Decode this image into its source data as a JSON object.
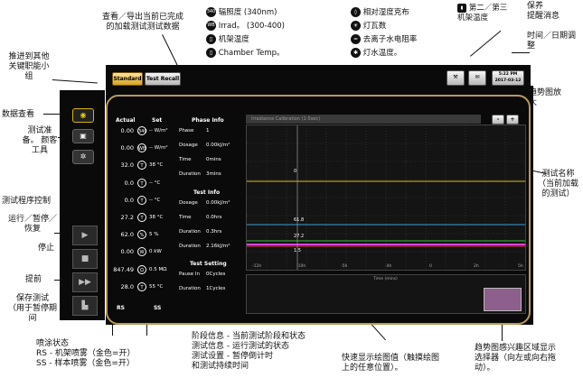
{
  "annotations": {
    "recall": "查看／导出当前已完成\n的加载测试测试数据",
    "push_keys": "推进到其他\n关键职能小\n组",
    "data_view": "数据查看",
    "test_prep": "测试准\n备。 颜客\n工具",
    "test_control": "测试程序控制",
    "run_pause": "运行／暂停／\n恢复",
    "stop": "停止",
    "advance": "提前",
    "save_test": "保存测试\n（用于暂停期\n间",
    "spray_status": "喷涂状态\nRS - 机架喷雾（金色=开）\nSS - 样本喷雾（金色=开）",
    "phase_info": "阶段信息 - 当前测试阶段和状态\n测试信息 - 运行测试的状态\n测试设置 - 暂停倒计时\n和测试持续时间",
    "cursor": "快速显示绘图值（触摸绘图\n上的任意位置）。",
    "trend_selector": "趋势图感兴趣区域显示\n选择器（向左或向右拖\n动）。",
    "test_name": "测试名称\n（当前加载\n的测试）",
    "zoom": "趋势图放\n大",
    "maintenance": "保养\n提醒消息",
    "datetime": "时间／日期调\n整"
  },
  "legend": {
    "irradiance_340": "辐照度 (340nm)",
    "irrad_range": "Irrad。 (300-400)",
    "rack_temp": "机架温度",
    "chamber_temp": "Chamber Temp。",
    "rh": "相对湿度克布",
    "lamp_watts": "灯瓦数",
    "di_water": "去离子水电阻率",
    "lamp_temp": "灯水温度。",
    "rack23_temp": "第二／第三\n机架温度"
  },
  "top_buttons": {
    "standard": "Standard",
    "test_recall": "Test Recall",
    "time": "5:22 PM",
    "date": "2017-03-12"
  },
  "readings": {
    "col_actual": "Actual",
    "col_set": "Set",
    "rows": [
      {
        "actual": "0.00",
        "icon": "340",
        "set": "-- W/m²"
      },
      {
        "actual": "0.00",
        "icon": "WB",
        "set": "-- W/m²"
      },
      {
        "actual": "32.0",
        "icon": "T",
        "set": "38 °C"
      },
      {
        "actual": "0.0",
        "icon": "T",
        "set": "-- °C"
      },
      {
        "actual": "0.0",
        "icon": "T",
        "set": "-- °C"
      },
      {
        "actual": "27.2",
        "icon": "T",
        "set": "38 °C"
      },
      {
        "actual": "62.0",
        "icon": "%",
        "set": "5 %"
      },
      {
        "actual": "0.00",
        "icon": "W",
        "set": "0 kW"
      },
      {
        "actual": "847.49",
        "icon": "Ω",
        "set": "0.5 MΩ"
      },
      {
        "actual": "28.0",
        "icon": "T",
        "set": "55 °C"
      }
    ],
    "rs": "RS",
    "ss": "SS"
  },
  "phase_info": {
    "title": "Phase Info",
    "rows": [
      {
        "k": "Phase",
        "v": "1"
      },
      {
        "k": "Dosage",
        "v": "0.00kJ/m²"
      },
      {
        "k": "Time",
        "v": "0mins"
      },
      {
        "k": "Duration",
        "v": "3mins"
      }
    ]
  },
  "test_info": {
    "title": "Test Info",
    "rows": [
      {
        "k": "Dosage",
        "v": "0.00kJ/m²"
      },
      {
        "k": "Time",
        "v": "0.0hrs"
      },
      {
        "k": "Duration",
        "v": "0.3hrs"
      },
      {
        "k": "Duration",
        "v": "2.16kJ/m²"
      }
    ]
  },
  "test_setting": {
    "title": "Test Setting",
    "rows": [
      {
        "k": "Pause In",
        "v": "0Cycles"
      },
      {
        "k": "Duration",
        "v": "1Cycles"
      }
    ]
  },
  "graph": {
    "title": "Irradiance Calibration (1-5sec)",
    "zoom_minus": "-",
    "zoom_plus": "+",
    "xlabel": "Time (mins)",
    "xticks": [
      "-12h",
      "-10h",
      "-5h",
      "-4h",
      "0",
      "2h",
      "5h"
    ],
    "markers": [
      "0",
      "61.8",
      "27.2",
      "1.5"
    ]
  },
  "colors": {
    "accent": "#d6a520",
    "frame": "#b89a5a"
  }
}
